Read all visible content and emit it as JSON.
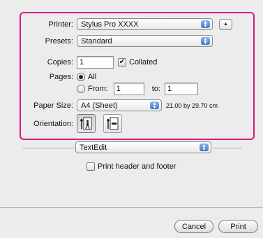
{
  "printer": {
    "label": "Printer:",
    "value": "Stylus Pro XXXX"
  },
  "presets": {
    "label": "Presets:",
    "value": "Standard"
  },
  "copies": {
    "label": "Copies:",
    "value": "1",
    "collated_label": "Collated",
    "collated_checked": true
  },
  "pages": {
    "label": "Pages:",
    "all_label": "All",
    "from_label": "From:",
    "from_value": "1",
    "to_label": "to:",
    "to_value": "1",
    "selected": "all"
  },
  "paper_size": {
    "label": "Paper Size:",
    "value": "A4 (Sheet)",
    "dimensions": "21.00 by 29.70 cm"
  },
  "orientation": {
    "label": "Orientation:",
    "selected": "portrait"
  },
  "section_popup": {
    "value": "TextEdit"
  },
  "print_header_footer": {
    "label": "Print header and footer",
    "checked": false
  },
  "buttons": {
    "cancel": "Cancel",
    "print": "Print"
  },
  "colors": {
    "highlight": "#d61b7b",
    "accent": "#3c79cf"
  }
}
